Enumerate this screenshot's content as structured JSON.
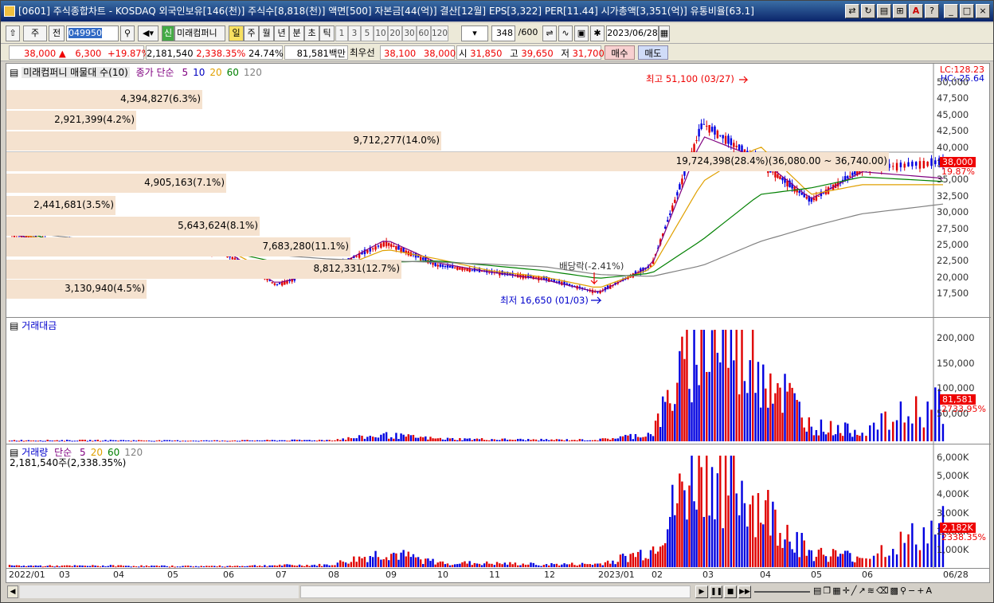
{
  "title": "[0601] 주식종합차트 - KOSDAQ 외국인보유[146(천)] 주식수[8,818(천)] 액면[500] 자본금[44(억)] 결산[12월] EPS[3,322] PER[11.44] 시가총액[3,351(억)] 유통비율[63.1]",
  "toolbar": {
    "market": "주",
    "all_label": "전",
    "code": "049950",
    "credit_label": "신",
    "stock_name": "미래컴퍼니",
    "periods": [
      "일",
      "주",
      "월",
      "년",
      "분",
      "초",
      "틱"
    ],
    "intervals": [
      "1",
      "3",
      "5",
      "10",
      "20",
      "30",
      "60",
      "120"
    ],
    "count": "348",
    "count_max": "/600",
    "date": "2023/06/28"
  },
  "quote": {
    "price": "38,000",
    "change": "6,300",
    "change_pct": "+19.87%",
    "volume": "2,181,540",
    "volume_pct": "2,338.35%",
    "turnover": "24.74%",
    "amount": "81,581백만",
    "best_ask_label": "최우선",
    "best_ask": "38,100",
    "best_bid": "38,000",
    "open_label": "시",
    "open": "31,850",
    "high_label": "고",
    "high": "39,650",
    "low_label": "저",
    "low": "31,700",
    "buy_label": "매수",
    "sell_label": "매도"
  },
  "price_panel": {
    "legend_profile": "미래컴퍼니 매물대 수(10)",
    "legend_ma_title": "종가 단순",
    "ma_periods": [
      "5",
      "10",
      "20",
      "60",
      "120"
    ],
    "ma_colors": [
      "#800080",
      "#0000c0",
      "#e0a000",
      "#008000",
      "#808080"
    ],
    "lc": "LC:128.23",
    "hc": "HC:-25.64",
    "high_annotation": "최고 51,100 (03/27)",
    "low_annotation": "최저 16,650 (01/03)",
    "dividend_annotation": "배당락(-2.41%)",
    "current_price": "38,000",
    "current_pct": "19.87%",
    "y_ticks": [
      "50,000",
      "47,500",
      "45,000",
      "42,500",
      "40,000",
      "37,500",
      "35,000",
      "32,500",
      "30,000",
      "27,500",
      "25,000",
      "22,500",
      "20,000",
      "17,500"
    ],
    "volume_profile": [
      {
        "label": "4,394,827(6.3%)",
        "share": 6.3
      },
      {
        "label": "2,921,399(4.2%)",
        "share": 4.2
      },
      {
        "label": "9,712,277(14.0%)",
        "share": 14.0
      },
      {
        "label": "19,724,398(28.4%)(36,080.00 ~ 36,740.00)",
        "share": 28.4
      },
      {
        "label": "4,905,163(7.1%)",
        "share": 7.1
      },
      {
        "label": "2,441,681(3.5%)",
        "share": 3.5
      },
      {
        "label": "5,643,624(8.1%)",
        "share": 8.1
      },
      {
        "label": "7,683,280(11.1%)",
        "share": 11.1
      },
      {
        "label": "8,812,331(12.7%)",
        "share": 12.7
      },
      {
        "label": "3,130,940(4.5%)",
        "share": 4.5
      }
    ]
  },
  "amount_panel": {
    "title": "거래대금",
    "current": "81,581",
    "current_pct": "2733.95%",
    "y_ticks": [
      "200,000",
      "150,000",
      "100,000",
      "50,000"
    ]
  },
  "volume_panel": {
    "title": "거래량",
    "legend_ma_title": "단순",
    "ma_periods": [
      "5",
      "20",
      "60",
      "120"
    ],
    "volume_text": "2,181,540주(2,338.35%)",
    "current": "2,182K",
    "current_pct": "2338.35%",
    "y_ticks": [
      "6,000K",
      "5,000K",
      "4,000K",
      "3,000K",
      "2,000K",
      "1,000K"
    ]
  },
  "x_axis": [
    "2022/01",
    "03",
    "04",
    "05",
    "06",
    "07",
    "08",
    "09",
    "10",
    "11",
    "12",
    "2023/01",
    "02",
    "03",
    "04",
    "05",
    "06",
    "06/28"
  ],
  "chart_data": {
    "type": "candlestick",
    "title": "미래컴퍼니 (049950) 일봉",
    "x": [
      "2022/01",
      "2022/03",
      "2022/04",
      "2022/05",
      "2022/06",
      "2022/07",
      "2022/08",
      "2022/09",
      "2022/10",
      "2022/11",
      "2022/12",
      "2023/01",
      "2023/02",
      "2023/03",
      "2023/04",
      "2023/05",
      "2023/06",
      "2023/06/28"
    ],
    "close": [
      27000,
      25500,
      25500,
      24500,
      24000,
      19000,
      21500,
      25500,
      22000,
      21000,
      20000,
      17800,
      22000,
      44000,
      38000,
      32000,
      37000,
      38000
    ],
    "ma": {
      "5": [
        27000,
        25000,
        25400,
        24200,
        24500,
        19200,
        21300,
        26000,
        22400,
        21000,
        19800,
        17800,
        22000,
        42000,
        38500,
        32300,
        36500,
        35500
      ],
      "20": [
        27000,
        25800,
        25200,
        24400,
        24700,
        20500,
        21000,
        24500,
        23000,
        21200,
        20200,
        18500,
        21500,
        35000,
        40500,
        33000,
        34500,
        34500
      ],
      "60": [
        28000,
        25500,
        25200,
        24600,
        24300,
        22500,
        21700,
        22500,
        22700,
        22000,
        21200,
        20000,
        20800,
        26000,
        33000,
        34000,
        35700,
        35000
      ],
      "120": [
        27500,
        26500,
        25600,
        24900,
        24500,
        23600,
        23000,
        22700,
        22500,
        22200,
        21800,
        20600,
        20300,
        22000,
        25700,
        28000,
        30000,
        31500
      ]
    },
    "amount": [
      2000,
      2000,
      2000,
      1500,
      1500,
      2000,
      2500,
      12000,
      5000,
      4000,
      3000,
      3000,
      15000,
      215000,
      160000,
      30000,
      20000,
      81581
    ],
    "volume_k": [
      80,
      70,
      80,
      60,
      60,
      100,
      120,
      800,
      250,
      200,
      150,
      170,
      900,
      6000,
      3300,
      800,
      550,
      2182
    ],
    "ylim": [
      15000,
      52000
    ],
    "annotations": [
      "최고 51,100 (03/27)",
      "최저 16,650 (01/03)",
      "배당락(-2.41%)"
    ]
  }
}
